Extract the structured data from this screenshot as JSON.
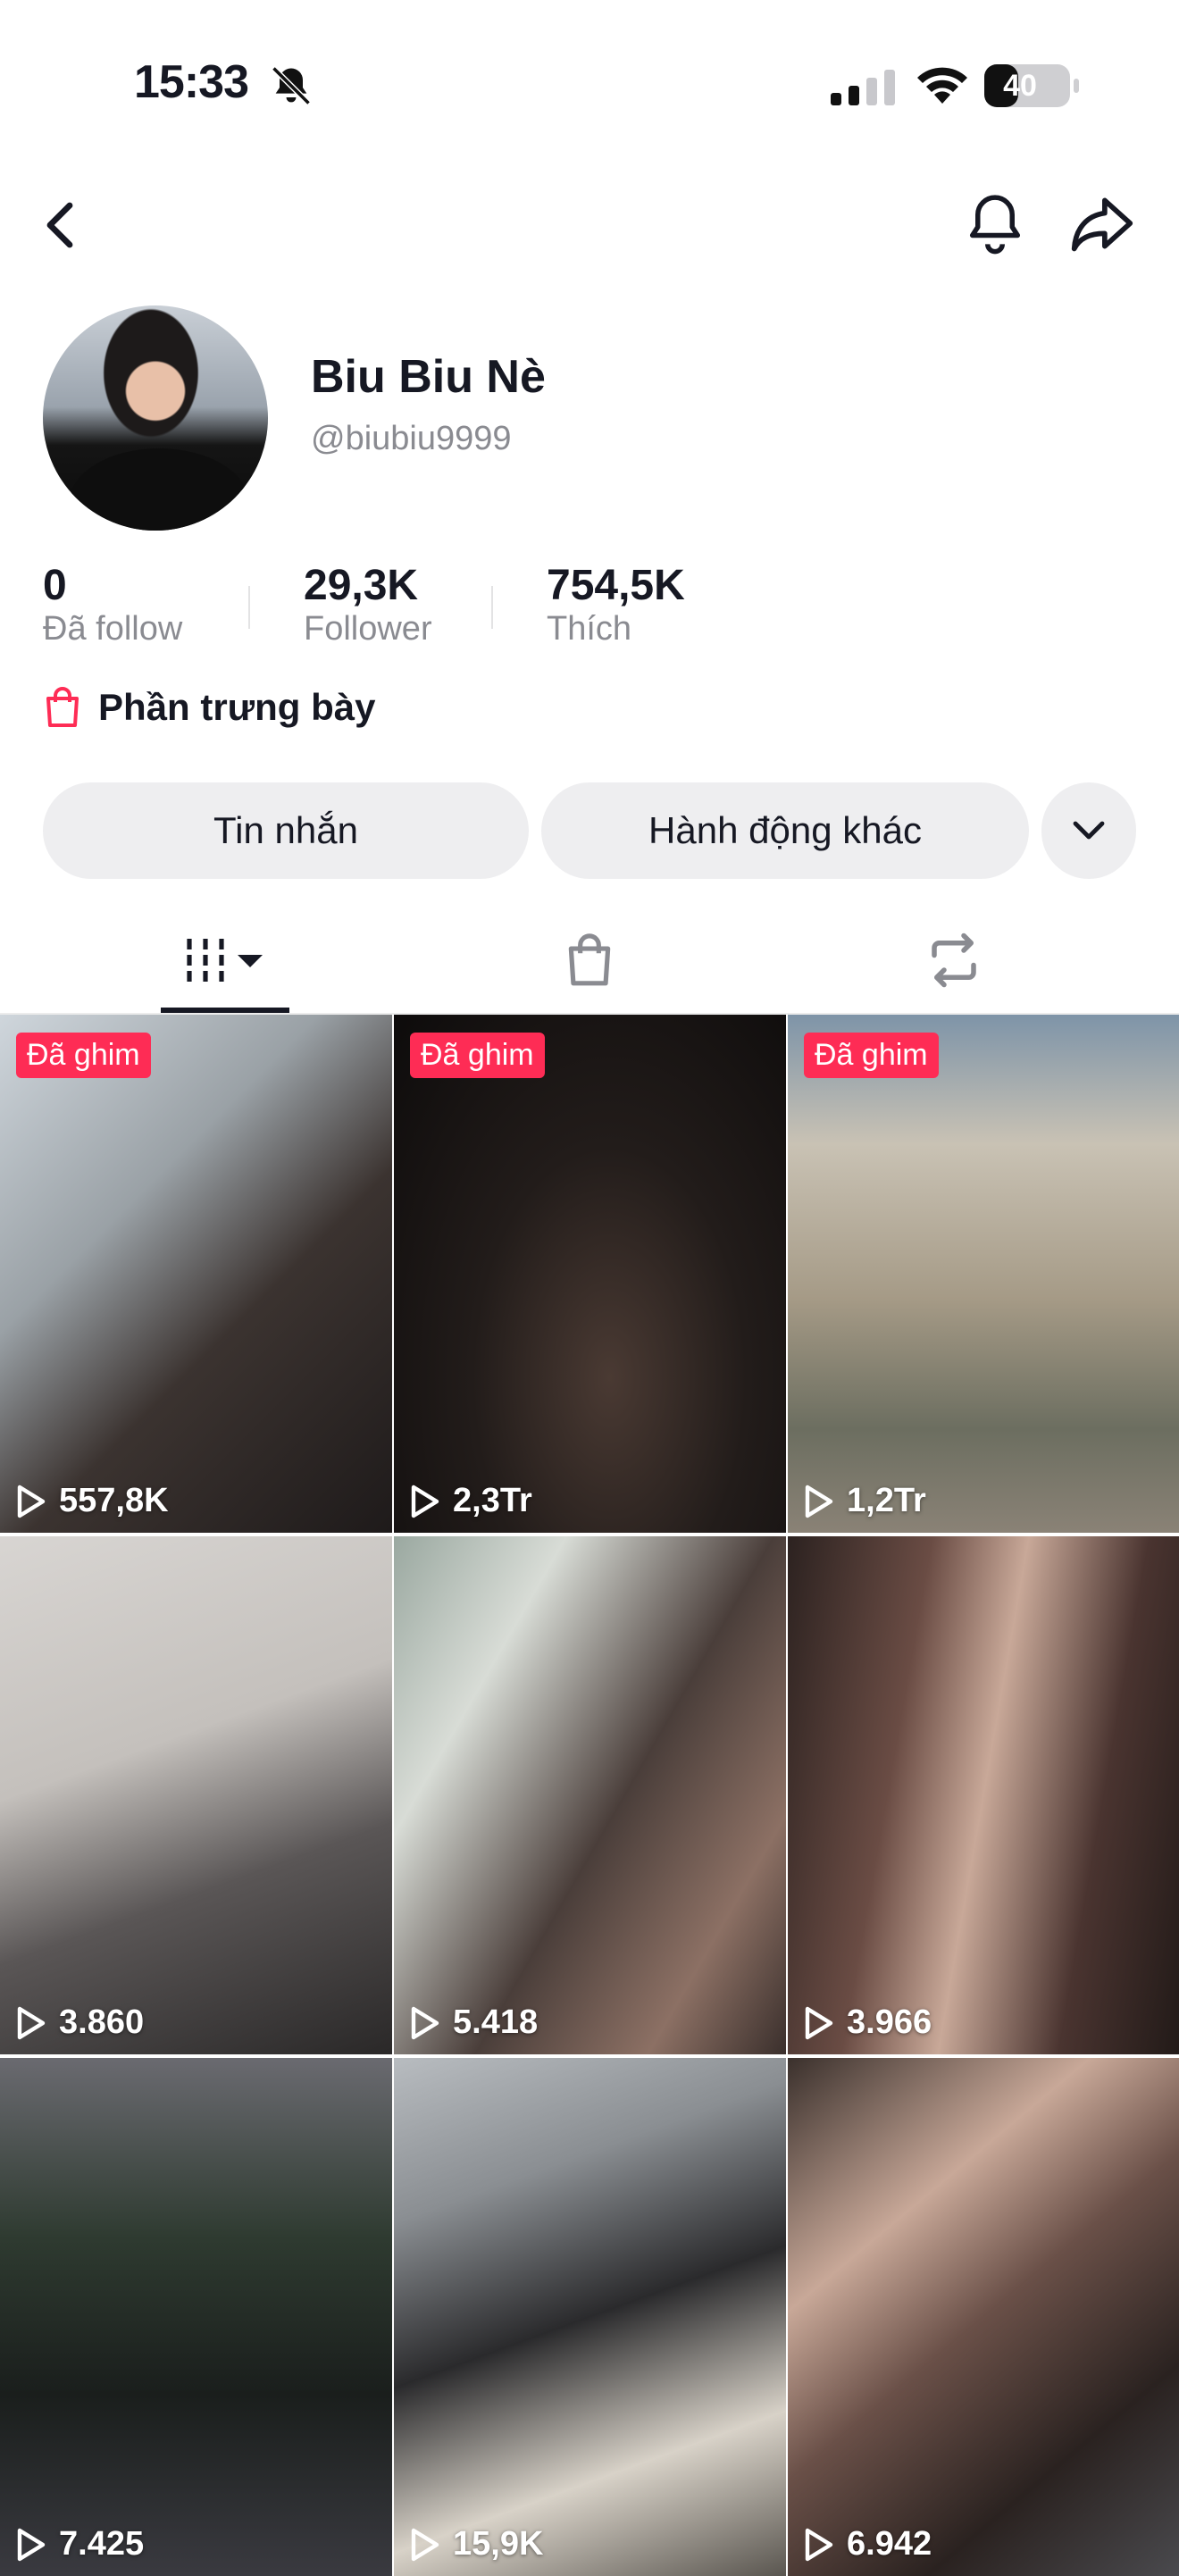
{
  "status_bar": {
    "time": "15:33",
    "battery": "40",
    "battery_level": 0.4
  },
  "nav": {
    "back_icon": "chevron-left-icon",
    "bell_icon": "bell-icon",
    "share_icon": "share-arrow-icon"
  },
  "profile": {
    "display_name": "Biu Biu Nè",
    "username": "@biubiu9999",
    "stats": [
      {
        "value": "0",
        "label": "Đã follow"
      },
      {
        "value": "29,3K",
        "label": "Follower"
      },
      {
        "value": "754,5K",
        "label": "Thích"
      }
    ],
    "showcase_label": "Phần trưng bày"
  },
  "actions": {
    "message_label": "Tin nhắn",
    "more_actions_label": "Hành động khác"
  },
  "tabs": {
    "videos_icon": "grid-icon",
    "shop_icon": "shopping-bag-icon",
    "repost_icon": "repost-icon"
  },
  "videos": [
    {
      "views": "557,8K",
      "badge": "Đã ghim"
    },
    {
      "views": "2,3Tr",
      "badge": "Đã ghim"
    },
    {
      "views": "1,2Tr",
      "badge": "Đã ghim"
    },
    {
      "views": "3.860"
    },
    {
      "views": "5.418"
    },
    {
      "views": "3.966"
    },
    {
      "views": "7.425"
    },
    {
      "views": "15,9K"
    },
    {
      "views": "6.942"
    }
  ],
  "colors": {
    "accent": "#fe2c55",
    "text": "#161823",
    "secondary": "#8a8b91",
    "pill_bg": "#eeeef0"
  }
}
